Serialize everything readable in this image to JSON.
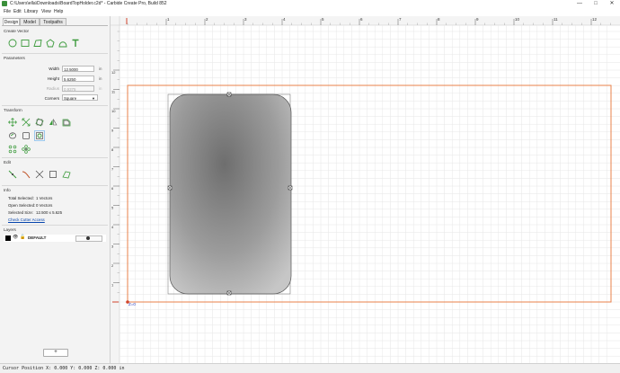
{
  "window": {
    "title": "C:\\Users\\ella\\Downloads\\BoardTopHolder.c2d* - Carbide Create Pro, Build 852",
    "minimize": "—",
    "maximize": "□",
    "close": "✕"
  },
  "menu": [
    "File",
    "Edit",
    "Library",
    "View",
    "Help"
  ],
  "tabs": [
    "Design",
    "Model",
    "Toolpaths"
  ],
  "create_vector": {
    "heading": "Create Vector",
    "tools": [
      "circle-icon",
      "rectangle-icon",
      "polygon-icon",
      "pentagon-icon",
      "curve-icon",
      "text-icon"
    ]
  },
  "parameters": {
    "heading": "Parameters",
    "width_label": "Width",
    "width_value": "12.5000",
    "width_unit": "in",
    "height_label": "Height",
    "height_value": "5.6250",
    "height_unit": "in",
    "radius_label": "Radius",
    "radius_value": "0.9375",
    "radius_unit": "in",
    "corners_label": "Corners",
    "corners_value": "Square"
  },
  "transform": {
    "heading": "Transform",
    "tools": [
      "move-icon",
      "scale-icon",
      "rotate-icon",
      "mirror-icon",
      "offset-icon",
      "group-icon",
      "center-icon",
      "array-icon",
      "align-icon"
    ]
  },
  "edit": {
    "heading": "Edit",
    "tools": [
      "node-edit-icon",
      "trim-icon",
      "extend-icon",
      "bounding-box-icon",
      "join-icon"
    ]
  },
  "info": {
    "heading": "Info",
    "total_selected_label": "Total Selected:",
    "total_selected_value": "1 Vectors",
    "open_selected_label": "Open Selected:",
    "open_selected_value": "0 Vectors",
    "selected_size_label": "Selected Size:",
    "selected_size_value": "12.500 x 5.625",
    "check_cutter_access": "Check Cutter Access"
  },
  "layers": {
    "heading": "Layers",
    "rows": [
      {
        "name": "DEFAULT",
        "color": "#000000"
      }
    ],
    "add_label": "+"
  },
  "ruler": {
    "x_ticks": [
      "1",
      "2",
      "3",
      "4",
      "5",
      "6",
      "7",
      "8",
      "9",
      "10",
      "11",
      "12"
    ],
    "y_ticks": [
      "12",
      "11",
      "10",
      "9",
      "8",
      "7",
      "6",
      "5",
      "4",
      "3",
      "2",
      "1"
    ]
  },
  "workspace": {
    "origin_label": "Z=0",
    "stock_color": "#e8804a",
    "shape": "rounded-rectangle"
  },
  "status": {
    "text": "Cursor Position X: 0.000 Y: 0.000 Z: 0.000 in"
  },
  "colors": {
    "accent_green": "#3a9a3a",
    "link_blue": "#0645ad"
  }
}
